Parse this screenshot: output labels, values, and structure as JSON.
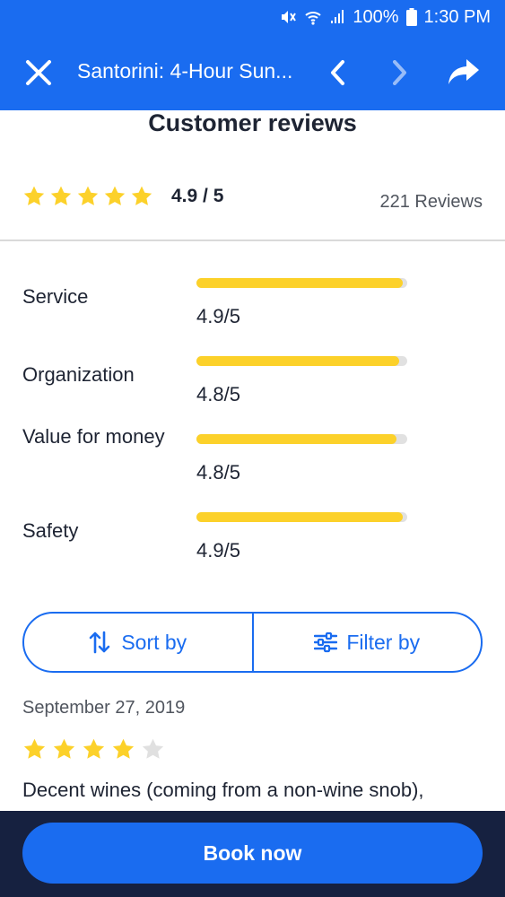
{
  "status_bar": {
    "battery": "100%",
    "time": "1:30 PM"
  },
  "app_bar": {
    "title": "Santorini: 4-Hour Sun..."
  },
  "reviews": {
    "heading": "Customer reviews",
    "overall_stars": 5,
    "overall_score": "4.9 / 5",
    "count_label": "221 Reviews",
    "categories": [
      {
        "label": "Service",
        "value": "4.9/5",
        "fill": 0.98
      },
      {
        "label": "Organization",
        "value": "4.8/5",
        "fill": 0.96
      },
      {
        "label": "Value for money",
        "value": "4.8/5",
        "fill": 0.95
      },
      {
        "label": "Safety",
        "value": "4.9/5",
        "fill": 0.98
      }
    ]
  },
  "controls": {
    "sort_label": "Sort by",
    "filter_label": "Filter by"
  },
  "review": {
    "date": "September 27, 2019",
    "stars": 4,
    "text": "Decent wines (coming from a non-wine snob),"
  },
  "footer": {
    "book_label": "Book now"
  },
  "colors": {
    "brand": "#1a6cf0",
    "star": "#fcd12a",
    "star_empty": "#e0e0e0",
    "footer_bg": "#162140"
  }
}
